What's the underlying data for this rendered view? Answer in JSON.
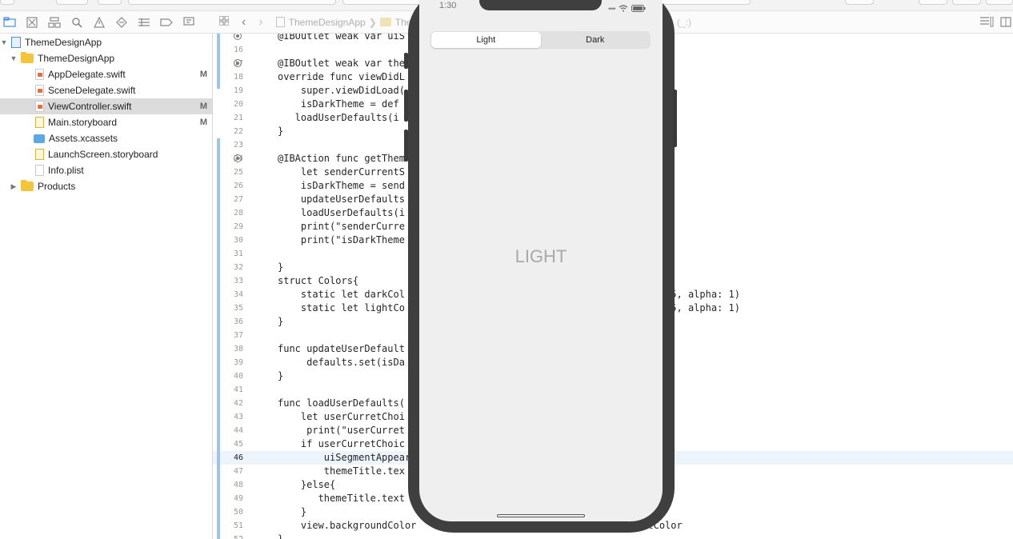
{
  "navigator": {
    "items": [
      {
        "label": "ThemeDesignApp",
        "status": ""
      },
      {
        "label": "ThemeDesignApp",
        "status": ""
      },
      {
        "label": "AppDelegate.swift",
        "status": "M"
      },
      {
        "label": "SceneDelegate.swift",
        "status": ""
      },
      {
        "label": "ViewController.swift",
        "status": "M"
      },
      {
        "label": "Main.storyboard",
        "status": "M"
      },
      {
        "label": "Assets.xcassets",
        "status": ""
      },
      {
        "label": "LaunchScreen.storyboard",
        "status": ""
      },
      {
        "label": "Info.plist",
        "status": ""
      },
      {
        "label": "Products",
        "status": ""
      }
    ]
  },
  "jumpbar": {
    "crumb1": "ThemeDesignApp",
    "crumb2": "The",
    "crumb_end": "(_:)"
  },
  "editor": {
    "current_line": "46",
    "lines": [
      {
        "n": "",
        "code": "@IBOutlet weak var uiS"
      },
      {
        "n": "16",
        "code": ""
      },
      {
        "n": "17",
        "code": "@IBOutlet weak var the"
      },
      {
        "n": "18",
        "code": "override func viewDidL"
      },
      {
        "n": "19",
        "code": "    super.viewDidLoad("
      },
      {
        "n": "20",
        "code": "    isDarkTheme = def"
      },
      {
        "n": "21",
        "code": "   loadUserDefaults(i"
      },
      {
        "n": "22",
        "code": "}"
      },
      {
        "n": "23",
        "code": ""
      },
      {
        "n": "24",
        "code": "@IBAction func getThem"
      },
      {
        "n": "25",
        "code": "    let senderCurrentS"
      },
      {
        "n": "26",
        "code": "    isDarkTheme = send"
      },
      {
        "n": "27",
        "code": "    updateUserDefaults"
      },
      {
        "n": "28",
        "code": "    loadUserDefaults(i"
      },
      {
        "n": "29",
        "code": "    print(\"senderCurre"
      },
      {
        "n": "30",
        "code": "    print(\"isDarkTheme"
      },
      {
        "n": "31",
        "code": ""
      },
      {
        "n": "32",
        "code": "}"
      },
      {
        "n": "33",
        "code": "struct Colors{"
      },
      {
        "n": "34",
        "code": "    static let darkCol                                    ue: 100/255, alpha: 1)"
      },
      {
        "n": "35",
        "code": "    static let lightCo                                   lue: 234/255, alpha: 1)"
      },
      {
        "n": "36",
        "code": "}"
      },
      {
        "n": "37",
        "code": ""
      },
      {
        "n": "38",
        "code": "func updateUserDefault"
      },
      {
        "n": "39",
        "code": "     defaults.set(isDa"
      },
      {
        "n": "40",
        "code": "}"
      },
      {
        "n": "41",
        "code": ""
      },
      {
        "n": "42",
        "code": "func loadUserDefaults("
      },
      {
        "n": "43",
        "code": "    let userCurretChoi"
      },
      {
        "n": "44",
        "code": "     print(\"userCurret"
      },
      {
        "n": "45",
        "code": "    if userCurretChoic"
      },
      {
        "n": "46",
        "code": "        uiSegmentAppear"
      },
      {
        "n": "47",
        "code": "        themeTitle.tex"
      },
      {
        "n": "48",
        "code": "    }else{"
      },
      {
        "n": "49",
        "code": "       themeTitle.text"
      },
      {
        "n": "50",
        "code": "    }"
      },
      {
        "n": "51",
        "code": "    view.backgroundColor                                  s.lightColor"
      },
      {
        "n": "52",
        "code": "}"
      }
    ]
  },
  "simulator": {
    "time": "1:30",
    "segments": [
      "Light",
      "Dark"
    ],
    "selected_segment": "Light",
    "title": "LIGHT"
  },
  "colors": {
    "folder": "#f4c53c",
    "swift": "#ef6a3a",
    "change_bar": "#9fc4ea",
    "device_frame": "#3f3f3f"
  }
}
